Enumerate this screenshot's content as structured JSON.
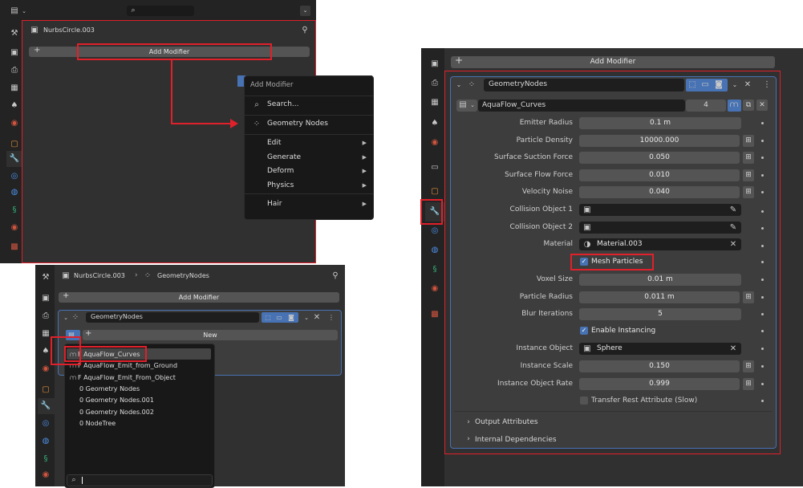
{
  "top_left": {
    "header_title": "NurbsCircle.003",
    "add_modifier": "Add Modifier",
    "popup": {
      "title": "Add Modifier",
      "search": "Search...",
      "geometry_nodes": "Geometry Nodes",
      "items": [
        "Edit",
        "Generate",
        "Deform",
        "Physics",
        "Hair"
      ]
    }
  },
  "bottom_left": {
    "breadcrumb_object": "NurbsCircle.003",
    "breadcrumb_modifier": "GeometryNodes",
    "add_modifier": "Add Modifier",
    "modifier_name": "GeometryNodes",
    "new_label": "New",
    "node_groups": [
      "F AquaFlow_Curves",
      "F AquaFlow_Emit_from_Ground",
      "F AquaFlow_Emit_From_Object",
      "0 Geometry Nodes",
      "0 Geometry Nodes.001",
      "0 Geometry Nodes.002",
      "0 NodeTree"
    ]
  },
  "right": {
    "add_modifier": "Add Modifier",
    "modifier_name": "GeometryNodes",
    "node_group": "AquaFlow_Curves",
    "user_count": "4",
    "fields": [
      {
        "label": "Emitter Radius",
        "value": "0.1 m"
      },
      {
        "label": "Particle Density",
        "value": "10000.000"
      },
      {
        "label": "Surface Suction Force",
        "value": "0.050"
      },
      {
        "label": "Surface Flow Force",
        "value": "0.010"
      },
      {
        "label": "Velocity Noise",
        "value": "0.040"
      }
    ],
    "collision1_label": "Collision Object 1",
    "collision2_label": "Collision Object 2",
    "material_label": "Material",
    "material_value": "Material.003",
    "mesh_particles": "Mesh Particles",
    "fields2": [
      {
        "label": "Voxel Size",
        "value": "0.01 m"
      },
      {
        "label": "Particle Radius",
        "value": "0.011 m"
      },
      {
        "label": "Blur Iterations",
        "value": "5"
      }
    ],
    "enable_instancing": "Enable Instancing",
    "instance_object_label": "Instance Object",
    "instance_object_value": "Sphere",
    "fields3": [
      {
        "label": "Instance Scale",
        "value": "0.150"
      },
      {
        "label": "Instance Object Rate",
        "value": "0.999"
      }
    ],
    "transfer_rest": "Transfer Rest Attribute (Slow)",
    "output_attributes": "Output Attributes",
    "internal_dependencies": "Internal Dependencies"
  },
  "colors": {
    "highlight": "#e0202a",
    "accent": "#4772b3"
  }
}
